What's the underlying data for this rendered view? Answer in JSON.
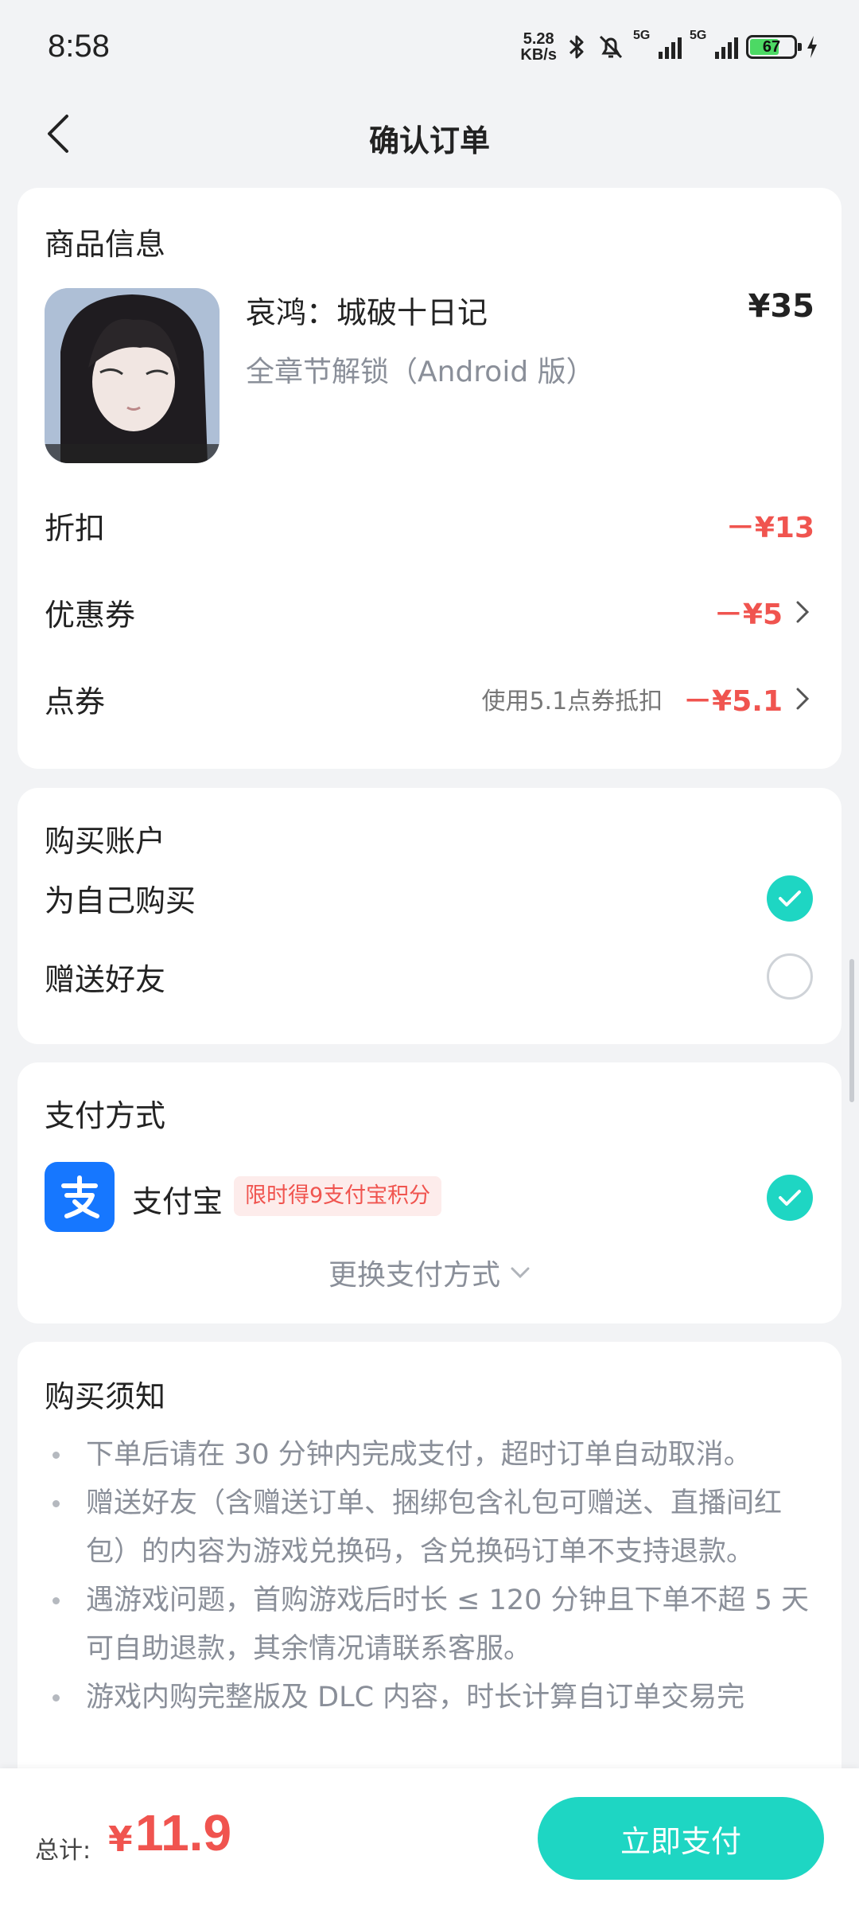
{
  "status_bar": {
    "time": "8:58",
    "net_speed_value": "5.28",
    "net_speed_unit": "KB/s",
    "signal1_label": "5G",
    "signal2_label": "5G",
    "battery_level": "67"
  },
  "header": {
    "title": "确认订单"
  },
  "product": {
    "section_title": "商品信息",
    "name": "哀鸿：城破十日记",
    "sku": "全章节解锁（Android 版）",
    "price": "¥35",
    "discount_label": "折扣",
    "discount_value": "－¥13",
    "coupon_label": "优惠券",
    "coupon_value": "－¥5",
    "points_label": "点券",
    "points_hint": "使用5.1点券抵扣",
    "points_value": "－¥5.1"
  },
  "account": {
    "section_title": "购买账户",
    "options": [
      {
        "label": "为自己购买",
        "selected": true
      },
      {
        "label": "赠送好友",
        "selected": false
      }
    ]
  },
  "payment": {
    "section_title": "支付方式",
    "method_name": "支付宝",
    "promo_tag": "限时得9支付宝积分",
    "change_label": "更换支付方式"
  },
  "notice": {
    "section_title": "购买须知",
    "items": [
      "下单后请在 30 分钟内完成支付，超时订单自动取消。",
      "赠送好友（含赠送订单、捆绑包含礼包可赠送、直播间红包）的内容为游戏兑换码，含兑换码订单不支持退款。",
      "遇游戏问题，首购游戏后时长 ≤ 120 分钟且下单不超 5 天可自助退款，其余情况请联系客服。",
      "游戏内购完整版及 DLC 内容，时长计算自订单交易完"
    ]
  },
  "footer": {
    "total_label": "总计:",
    "currency": "¥",
    "total_value": "11.9",
    "pay_button": "立即支付"
  },
  "colors": {
    "accent": "#1ed6c3",
    "price_red": "#f0544f",
    "alipay_blue": "#1677ff"
  }
}
